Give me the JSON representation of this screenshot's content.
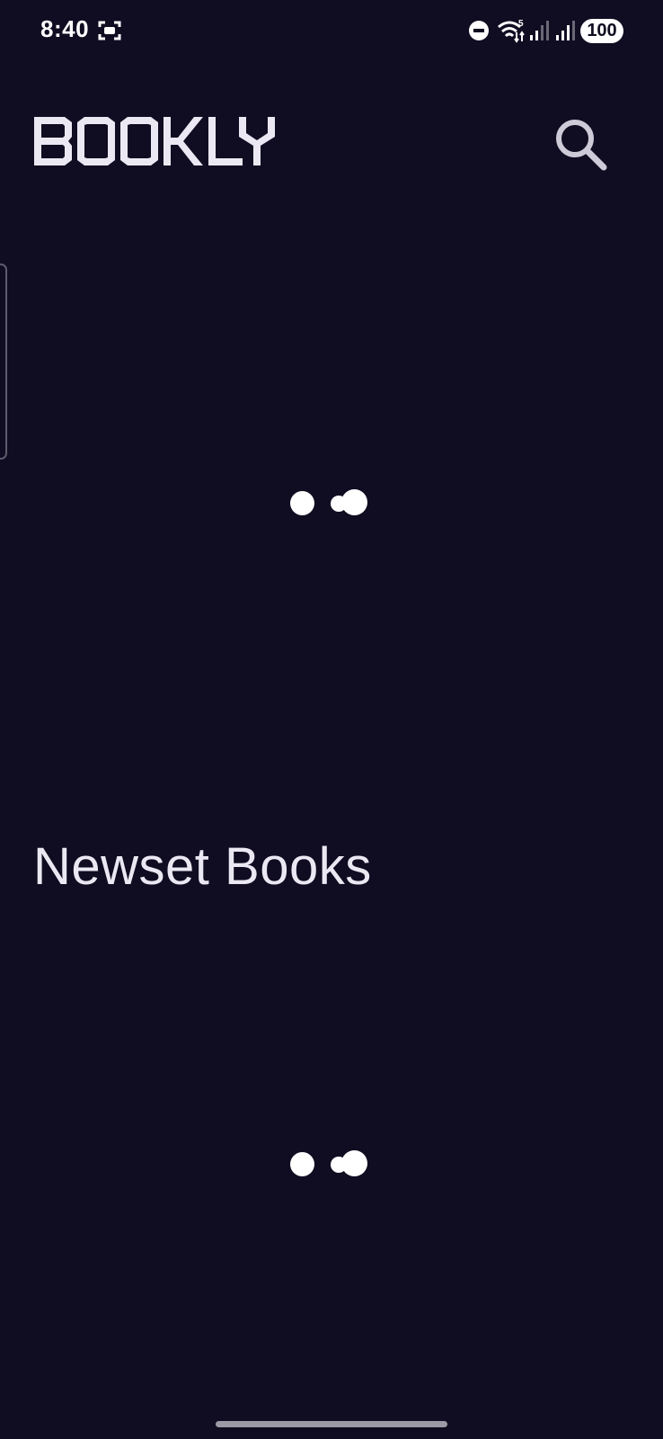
{
  "status_bar": {
    "time": "8:40",
    "battery": "100",
    "icons": [
      "screenshot-icon",
      "do-not-disturb-icon",
      "wifi-icon",
      "signal-icon",
      "signal-icon"
    ]
  },
  "header": {
    "logo_text": "BOOKLY",
    "search_icon": "search-icon"
  },
  "sections": {
    "newest_books_title": "Newset Books"
  },
  "colors": {
    "background": "#100d22",
    "text": "#e9e4ef",
    "accent": "#ffffff"
  }
}
